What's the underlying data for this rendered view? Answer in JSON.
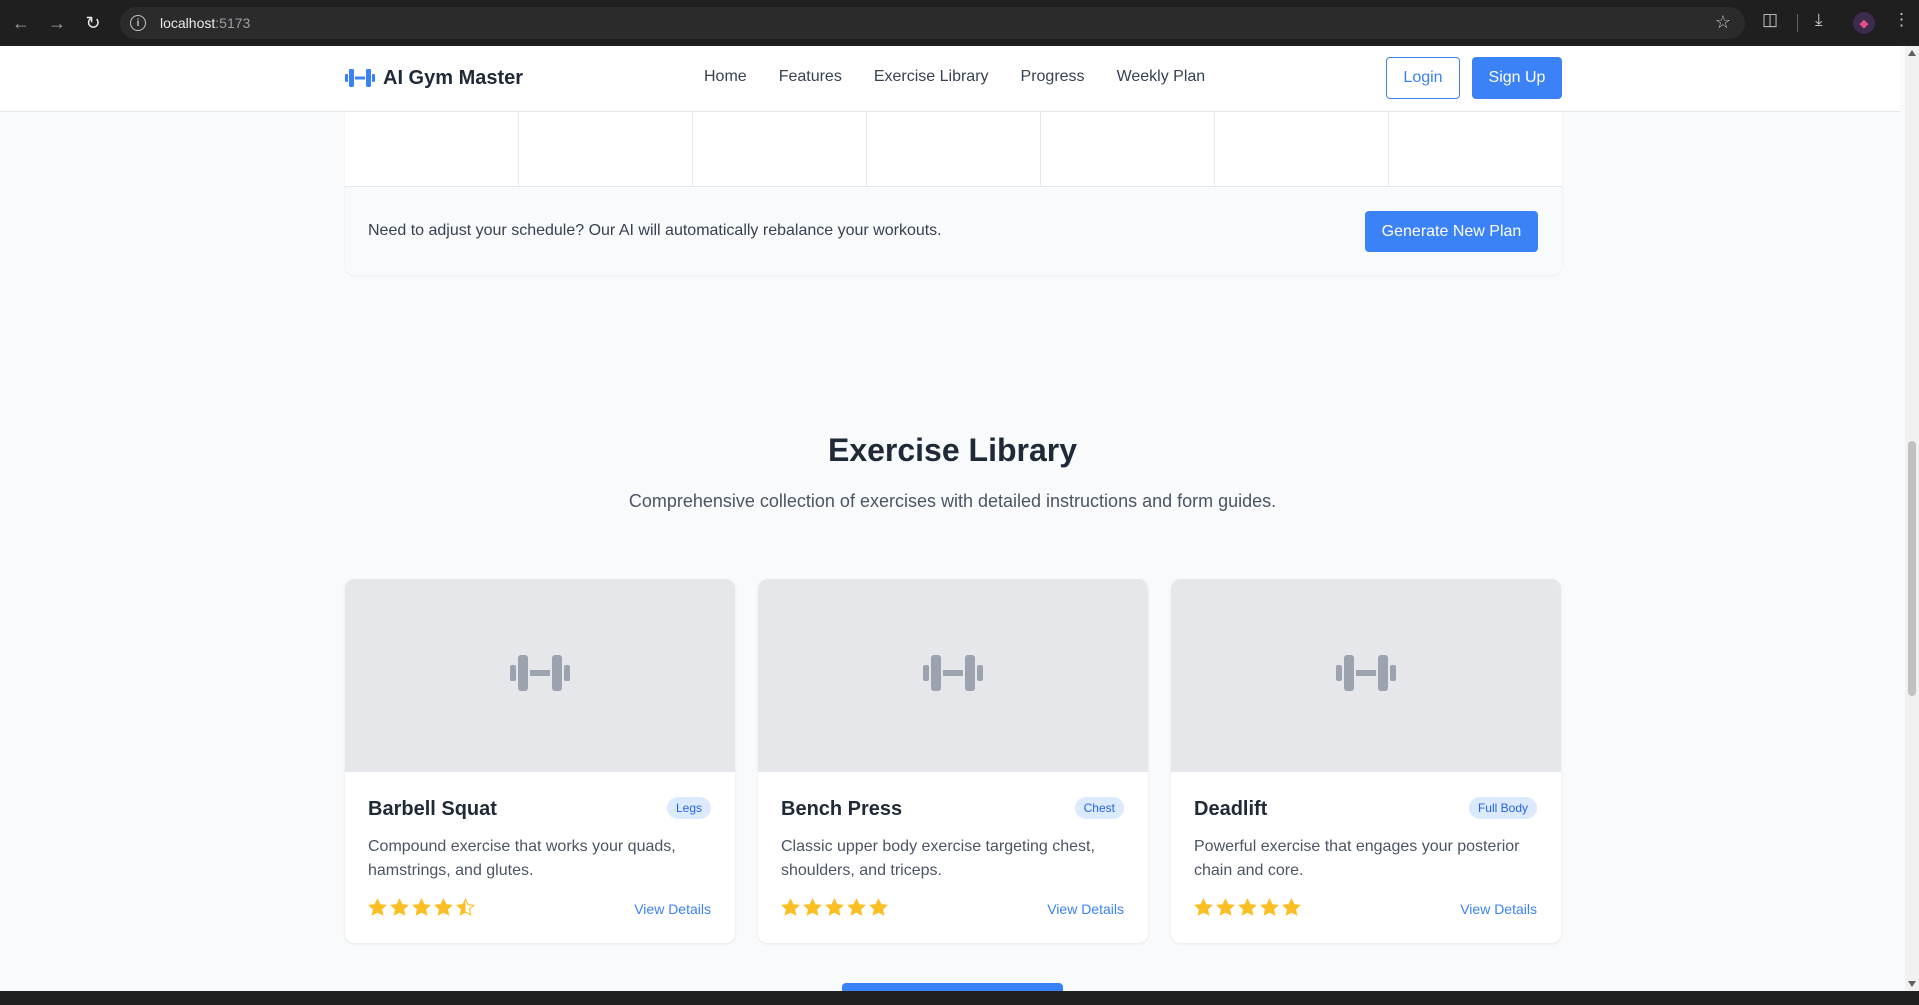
{
  "browser": {
    "url_host": "localhost",
    "url_port": ":5173"
  },
  "header": {
    "logo_text": "AI Gym Master",
    "nav": [
      "Home",
      "Features",
      "Exercise Library",
      "Progress",
      "Weekly Plan"
    ],
    "login_label": "Login",
    "signup_label": "Sign Up"
  },
  "weekly_plan": {
    "note": "Need to adjust your schedule? Our AI will automatically rebalance your workouts.",
    "generate_label": "Generate New Plan"
  },
  "exercise_library": {
    "title": "Exercise Library",
    "subtitle": "Comprehensive collection of exercises with detailed instructions and form guides.",
    "cards": [
      {
        "name": "Barbell Squat",
        "tag": "Legs",
        "description": "Compound exercise that works your quads, hamstrings, and glutes.",
        "rating": 4.5,
        "link": "View Details"
      },
      {
        "name": "Bench Press",
        "tag": "Chest",
        "description": "Classic upper body exercise targeting chest, shoulders, and triceps.",
        "rating": 5,
        "link": "View Details"
      },
      {
        "name": "Deadlift",
        "tag": "Full Body",
        "description": "Powerful exercise that engages your posterior chain and core.",
        "rating": 5,
        "link": "View Details"
      }
    ]
  },
  "colors": {
    "accent": "#3b82f6",
    "star": "#fbbf24",
    "placeholder_bg": "#e5e7eb",
    "tag_bg": "#dbeafe"
  },
  "icons": [
    "back-icon",
    "forward-icon",
    "reload-icon",
    "info-icon",
    "star-bookmark-icon",
    "extensions-icon",
    "download-icon",
    "menu-icon",
    "dumbbell-icon",
    "star-icon",
    "half-star-icon"
  ]
}
